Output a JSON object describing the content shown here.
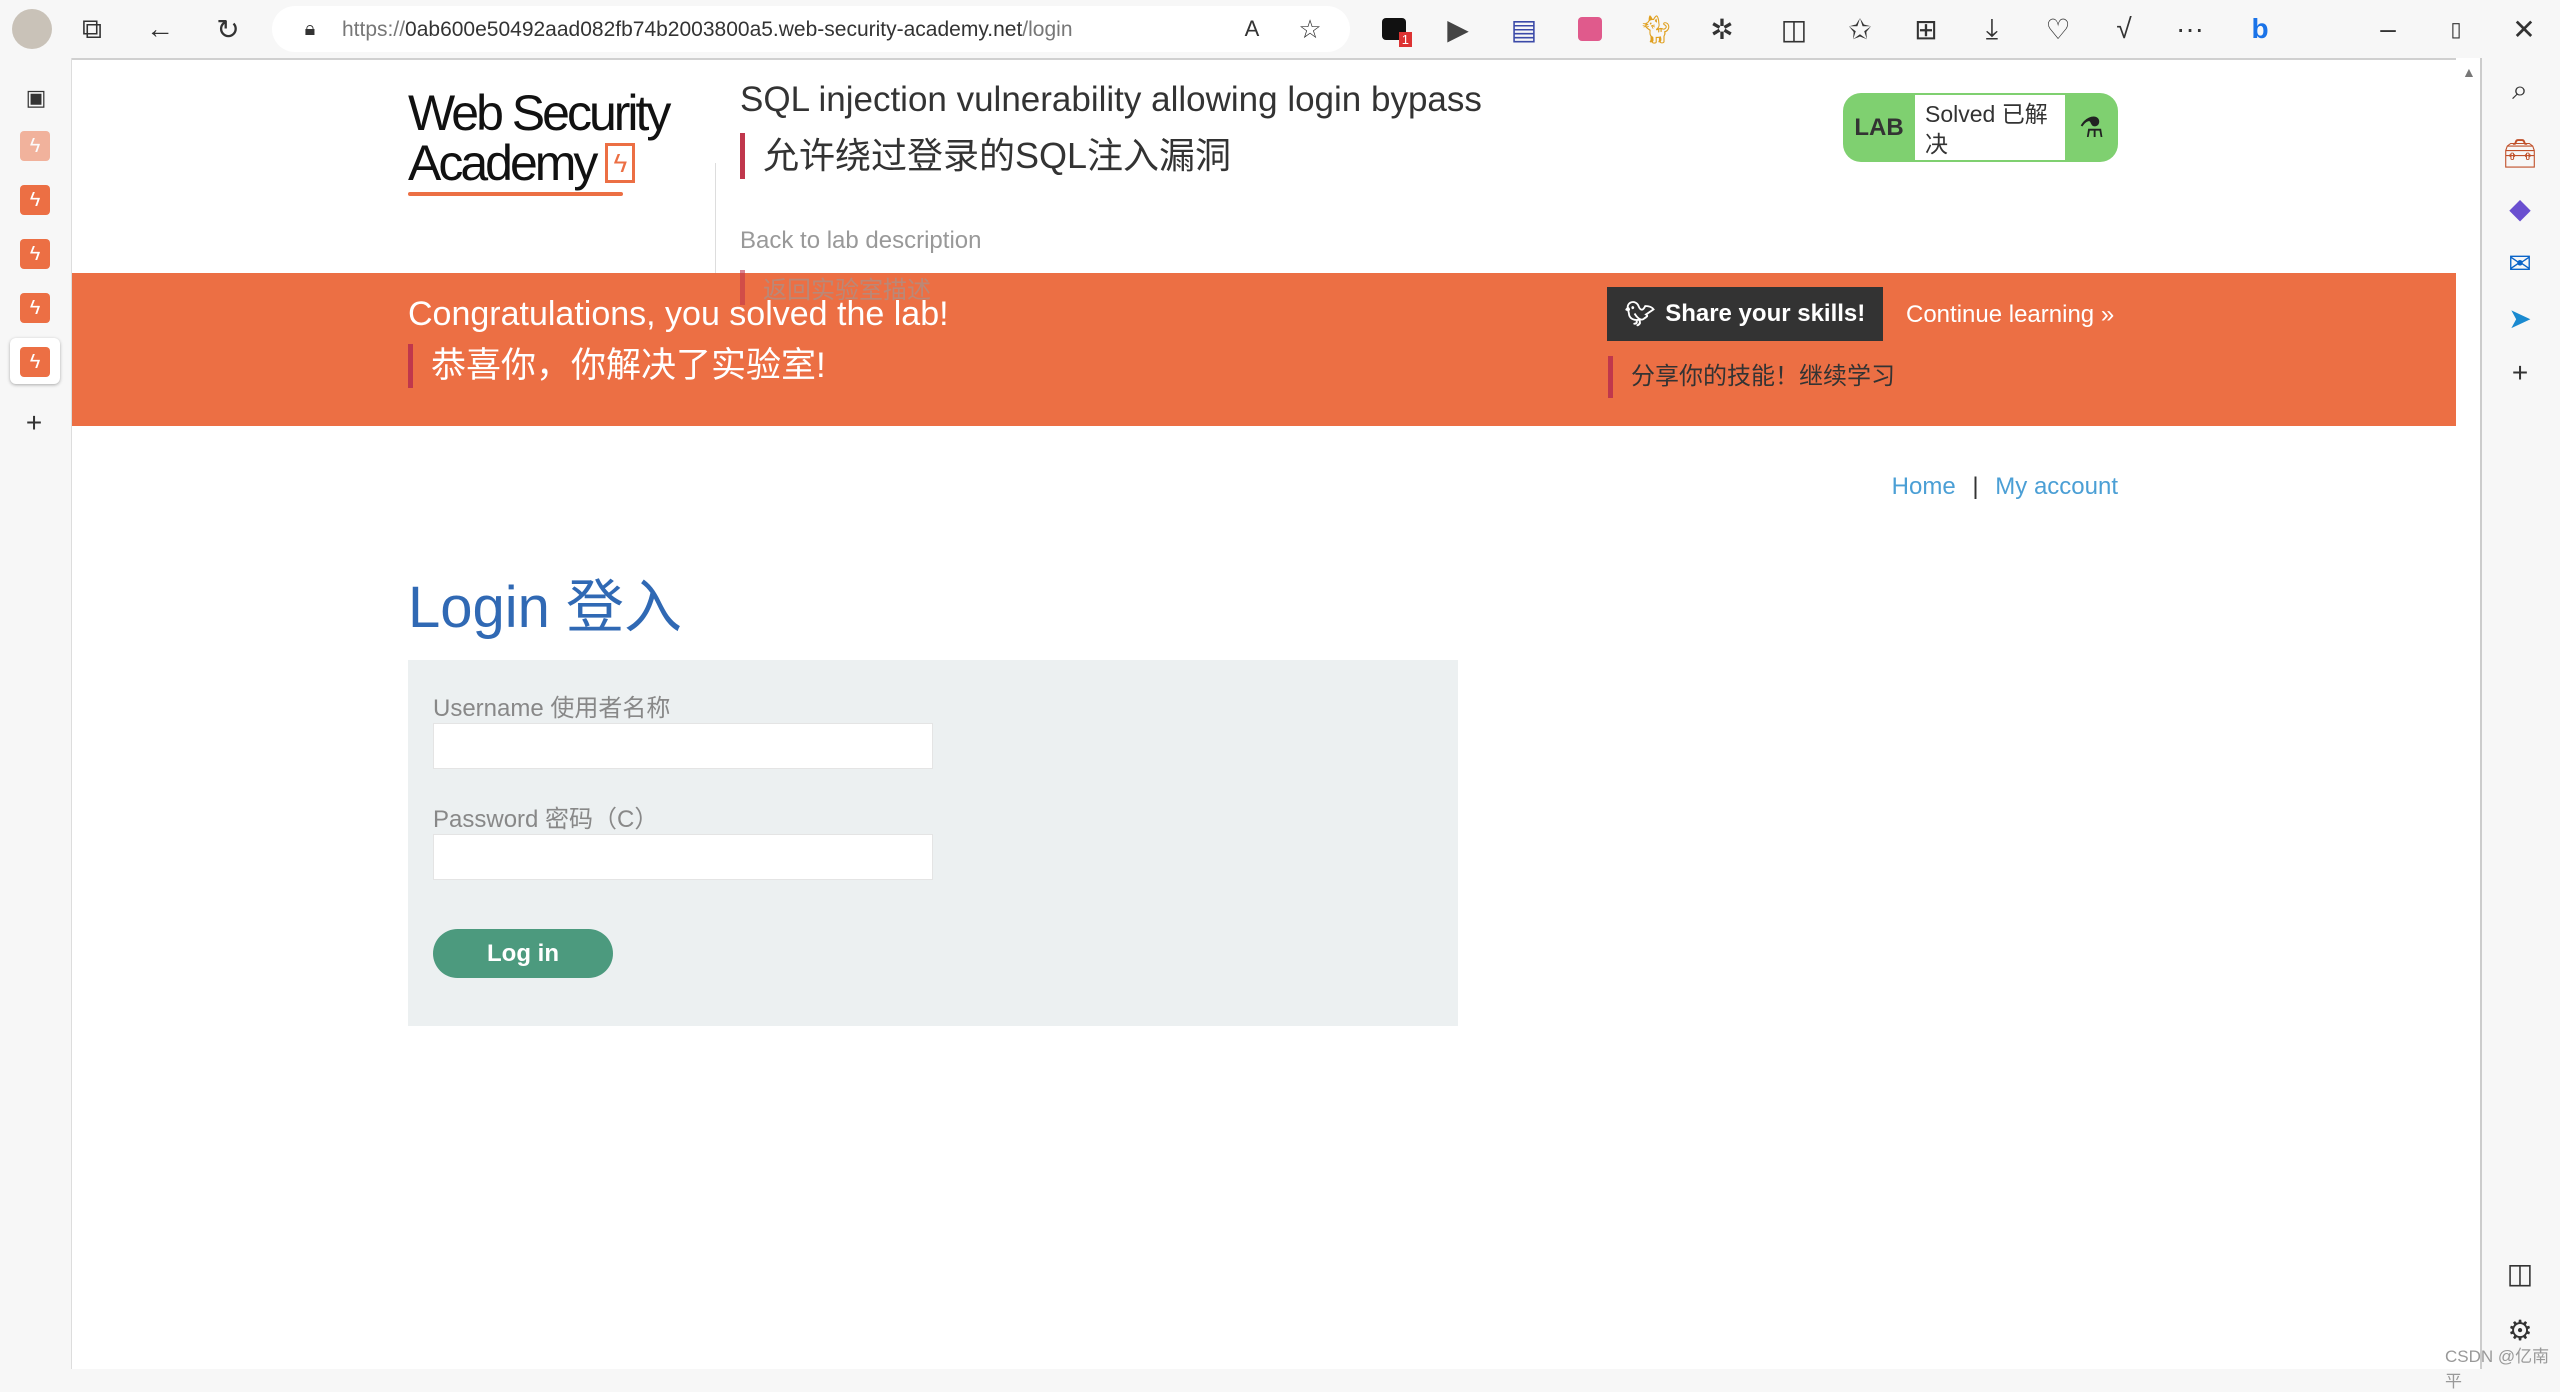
{
  "browser": {
    "url_prefix": "https://",
    "url_host": "0ab600e50492aad082fb74b2003800a5.web-security-academy.net",
    "url_path": "/login",
    "notification_count": "1",
    "watermark": "CSDN @亿南平"
  },
  "header": {
    "logo_line1": "Web Security",
    "logo_line2": "Academy",
    "lab_title": "SQL injection vulnerability allowing login bypass",
    "lab_title_cn": "允许绕过登录的SQL注入漏洞",
    "back_link": "Back to lab description",
    "back_link_cn": "返回实验室描述",
    "badge_lab": "LAB",
    "badge_status": "Solved 已解决"
  },
  "banner": {
    "congrats": "Congratulations, you solved the lab!",
    "congrats_cn": "恭喜你，你解决了实验室!",
    "share": "Share your skills!",
    "continue": "Continue learning",
    "share_cn": "分享你的技能！继续学习",
    "color": "#ec6f44"
  },
  "nav": {
    "home": "Home",
    "separator": "|",
    "account": "My account"
  },
  "login": {
    "heading": "Login 登入",
    "username_label": "Username 使用者名称",
    "username_value": "",
    "password_label": "Password 密码（C）",
    "password_value": "",
    "submit": "Log in"
  },
  "colors": {
    "accent": "#ec6f44",
    "button": "#4c9a7e",
    "heading": "#3069b4",
    "badge": "#7fd070"
  }
}
